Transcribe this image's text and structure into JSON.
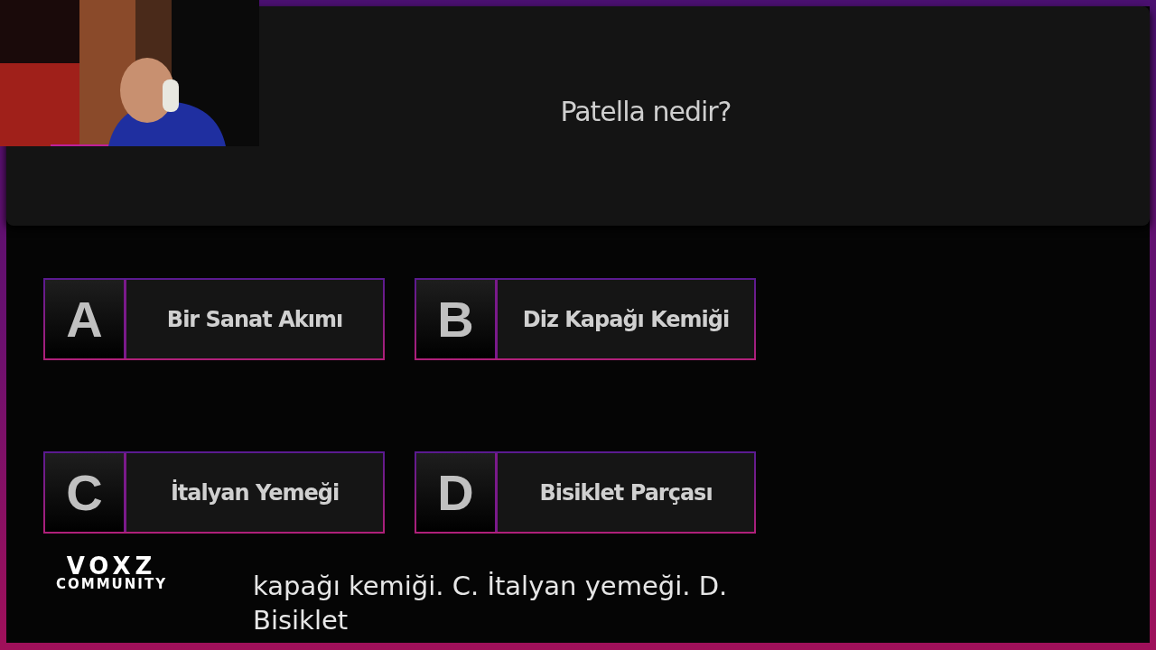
{
  "question": "Patella nedir?",
  "answers": [
    {
      "letter": "A",
      "text": "Bir Sanat Akımı"
    },
    {
      "letter": "B",
      "text": "Diz Kapağı Kemiği"
    },
    {
      "letter": "C",
      "text": "İtalyan Yemeği"
    },
    {
      "letter": "D",
      "text": "Bisiklet Parçası"
    }
  ],
  "logo": {
    "title": "VOXZ",
    "subtitle": "COMMUNITY"
  },
  "captions": [
    "kapağı kemiği. C. İtalyan yemeği. D.",
    "Bisiklet"
  ]
}
